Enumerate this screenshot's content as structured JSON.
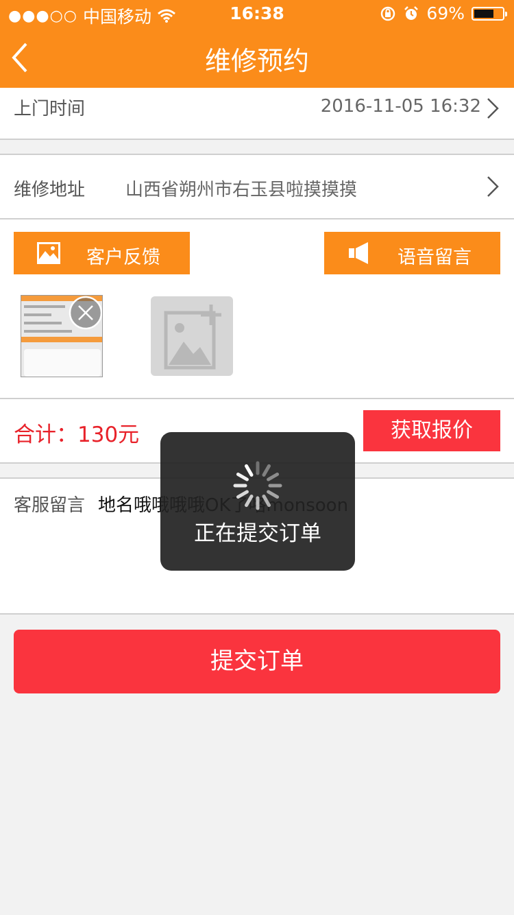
{
  "status_bar": {
    "signal_dots": "●●●○○",
    "carrier": "中国移动",
    "time": "16:38",
    "battery": "69%",
    "battery_level": 0.69
  },
  "nav": {
    "title": "维修预约",
    "back_icon": "chevron-left-icon"
  },
  "visit_time": {
    "label": "上门时间",
    "value": "2016-11-05 16:32"
  },
  "address": {
    "label": "维修地址",
    "value": "山西省朔州市右玉县啦摸摸摸"
  },
  "actions": {
    "feedback_label": "客户反馈",
    "feedback_icon": "image-icon",
    "voice_label": "语音留言",
    "voice_icon": "speaker-icon"
  },
  "photos": {
    "thumbnail_icon": "photo-thumbnail",
    "remove_icon": "close-icon",
    "add_icon": "add-photo-icon"
  },
  "total": {
    "label": "合计：",
    "amount": "130元",
    "quote_button": "获取报价"
  },
  "service_message": {
    "label": "客服留言",
    "text": "地名哦哦哦哦OK了咯monsoon"
  },
  "submit": {
    "label": "提交订单"
  },
  "toast": {
    "text": "正在提交订单",
    "icon": "spinner-icon"
  },
  "colors": {
    "accent": "#fb8c1a",
    "danger": "#fa343e",
    "total_text": "#e8222a"
  }
}
